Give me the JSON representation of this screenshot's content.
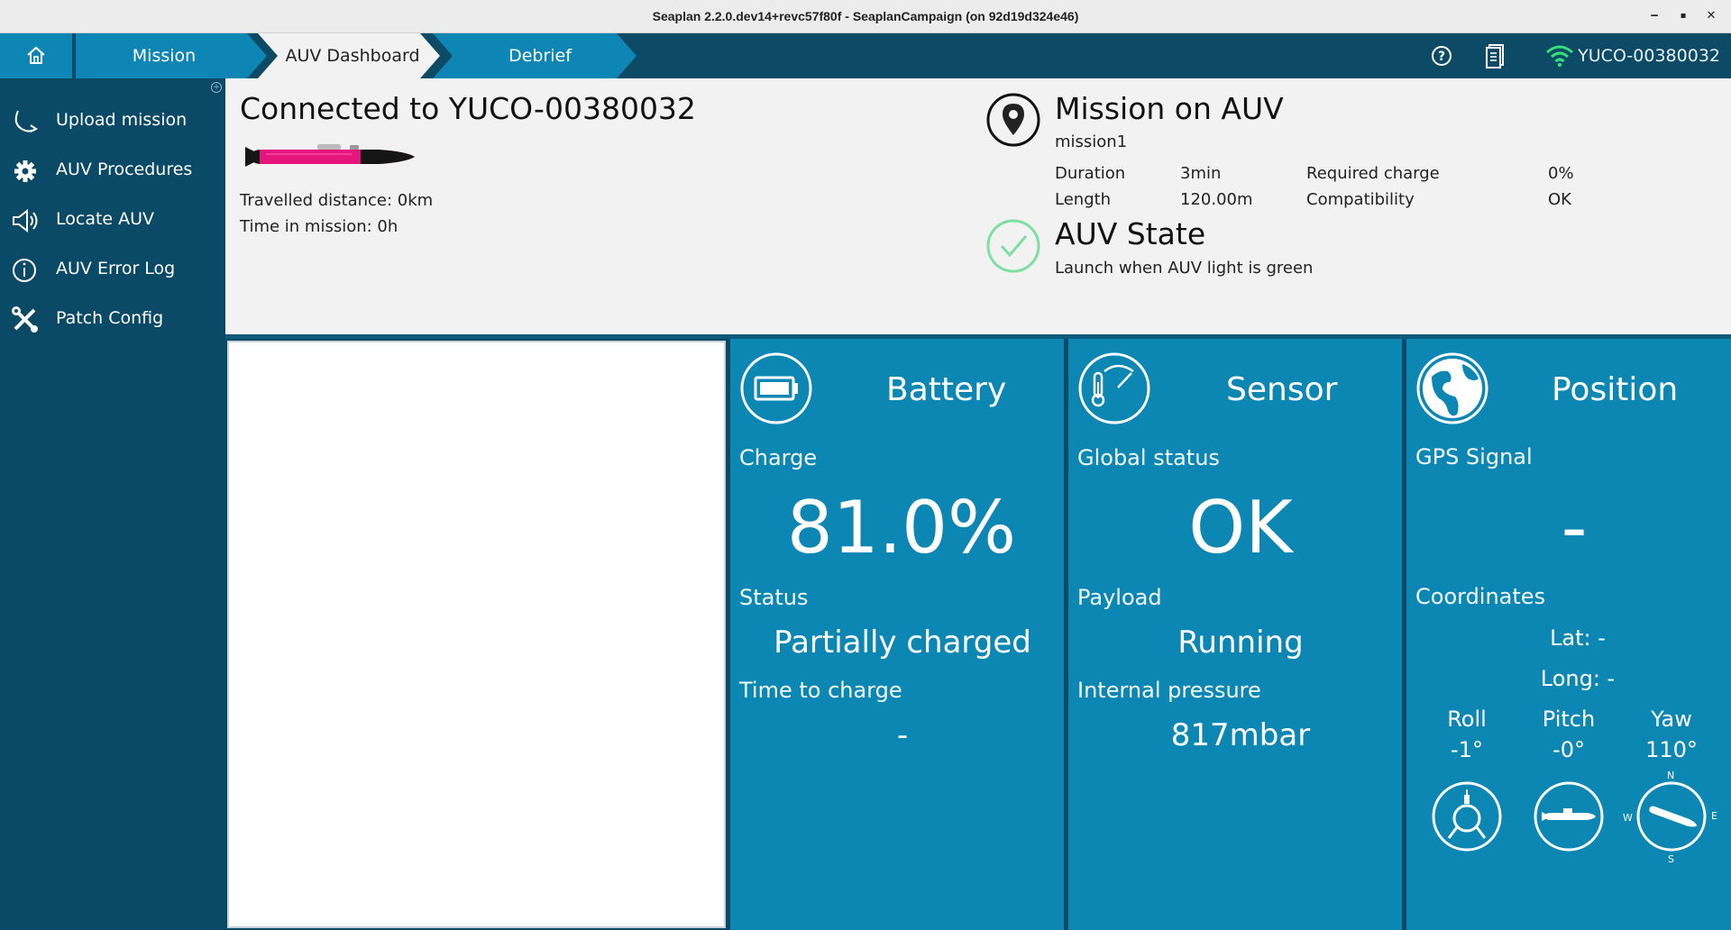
{
  "window": {
    "title": "Seaplan 2.2.0.dev14+revc57f80f - SeaplanCampaign (on 92d19d324e46)"
  },
  "nav": {
    "tabs": [
      {
        "label": "Mission"
      },
      {
        "label": "AUV Dashboard"
      },
      {
        "label": "Debrief"
      }
    ],
    "device_name": "YUCO-00380032"
  },
  "sidebar": {
    "items": [
      {
        "label": "Upload mission",
        "icon": "upload-mission-icon"
      },
      {
        "label": "AUV Procedures",
        "icon": "gear-icon"
      },
      {
        "label": "Locate AUV",
        "icon": "speaker-icon"
      },
      {
        "label": "AUV Error Log",
        "icon": "info-icon"
      },
      {
        "label": "Patch Config",
        "icon": "tools-icon"
      }
    ]
  },
  "connection": {
    "title": "Connected to YUCO-00380032",
    "travelled": "Travelled distance: 0km",
    "time_in_mission": "Time in mission: 0h"
  },
  "mission": {
    "title": "Mission on AUV",
    "name": "mission1",
    "duration_label": "Duration",
    "duration_value": "3min",
    "length_label": "Length",
    "length_value": "120.00m",
    "charge_label": "Required charge",
    "charge_value": "0%",
    "compat_label": "Compatibility",
    "compat_value": "OK"
  },
  "auv_state": {
    "title": "AUV State",
    "subtitle": "Launch when AUV light is green"
  },
  "battery": {
    "title": "Battery",
    "charge_label": "Charge",
    "charge_value": "81.0%",
    "status_label": "Status",
    "status_value": "Partially charged",
    "ttc_label": "Time to charge",
    "ttc_value": "-"
  },
  "sensor": {
    "title": "Sensor",
    "global_label": "Global status",
    "global_value": "OK",
    "payload_label": "Payload",
    "payload_value": "Running",
    "pressure_label": "Internal pressure",
    "pressure_value": "817mbar"
  },
  "position": {
    "title": "Position",
    "gps_label": "GPS Signal",
    "gps_value": "-",
    "coord_label": "Coordinates",
    "lat": "Lat: -",
    "long": "Long: -",
    "roll_label": "Roll",
    "roll_value": "-1°",
    "pitch_label": "Pitch",
    "pitch_value": "-0°",
    "yaw_label": "Yaw",
    "yaw_value": "110°",
    "compass": {
      "n": "N",
      "e": "E",
      "s": "S",
      "w": "W"
    }
  },
  "colors": {
    "nav_bg": "#0c4a65",
    "tab_active": "#f2f2f2",
    "tab_inactive": "#0e86b5",
    "panel": "#0c87b3",
    "ok_green": "#7ee0a0"
  }
}
